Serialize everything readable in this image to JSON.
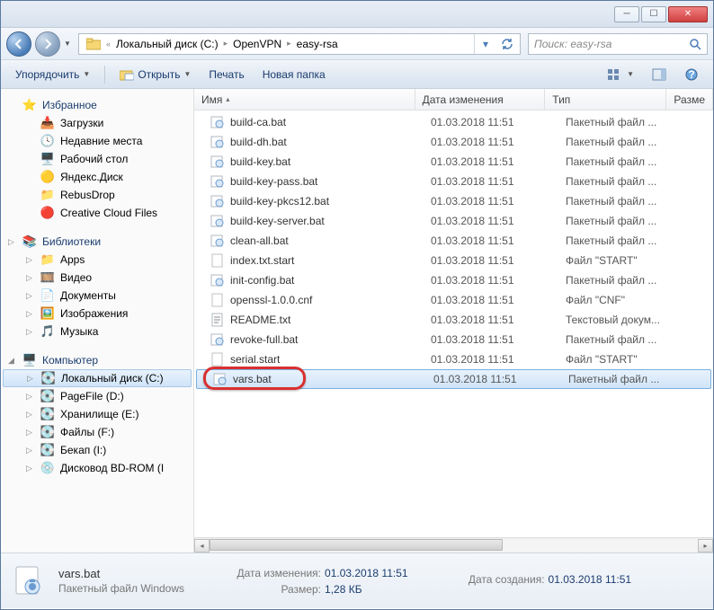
{
  "breadcrumb": {
    "root_sep": "«",
    "seg1": "Локальный диск (C:)",
    "seg2": "OpenVPN",
    "seg3": "easy-rsa"
  },
  "search": {
    "placeholder": "Поиск: easy-rsa"
  },
  "toolbar": {
    "organize": "Упорядочить",
    "open": "Открыть",
    "print": "Печать",
    "newfolder": "Новая папка"
  },
  "sidebar": {
    "favorites": "Избранное",
    "fav_items": [
      "Загрузки",
      "Недавние места",
      "Рабочий стол",
      "Яндекс.Диск",
      "RebusDrop",
      "Creative Cloud Files"
    ],
    "libraries": "Библиотеки",
    "lib_items": [
      "Apps",
      "Видео",
      "Документы",
      "Изображения",
      "Музыка"
    ],
    "computer": "Компьютер",
    "drives": [
      "Локальный диск (C:)",
      "PageFile (D:)",
      "Хранилище (E:)",
      "Файлы (F:)",
      "Бекап (I:)",
      "Дисковод BD-ROM (I"
    ]
  },
  "columns": {
    "name": "Имя",
    "date": "Дата изменения",
    "type": "Тип",
    "size": "Разме"
  },
  "files": [
    {
      "name": "build-ca.bat",
      "date": "01.03.2018 11:51",
      "type": "Пакетный файл ..."
    },
    {
      "name": "build-dh.bat",
      "date": "01.03.2018 11:51",
      "type": "Пакетный файл ..."
    },
    {
      "name": "build-key.bat",
      "date": "01.03.2018 11:51",
      "type": "Пакетный файл ..."
    },
    {
      "name": "build-key-pass.bat",
      "date": "01.03.2018 11:51",
      "type": "Пакетный файл ..."
    },
    {
      "name": "build-key-pkcs12.bat",
      "date": "01.03.2018 11:51",
      "type": "Пакетный файл ..."
    },
    {
      "name": "build-key-server.bat",
      "date": "01.03.2018 11:51",
      "type": "Пакетный файл ..."
    },
    {
      "name": "clean-all.bat",
      "date": "01.03.2018 11:51",
      "type": "Пакетный файл ..."
    },
    {
      "name": "index.txt.start",
      "date": "01.03.2018 11:51",
      "type": "Файл \"START\""
    },
    {
      "name": "init-config.bat",
      "date": "01.03.2018 11:51",
      "type": "Пакетный файл ..."
    },
    {
      "name": "openssl-1.0.0.cnf",
      "date": "01.03.2018 11:51",
      "type": "Файл \"CNF\""
    },
    {
      "name": "README.txt",
      "date": "01.03.2018 11:51",
      "type": "Текстовый докум..."
    },
    {
      "name": "revoke-full.bat",
      "date": "01.03.2018 11:51",
      "type": "Пакетный файл ..."
    },
    {
      "name": "serial.start",
      "date": "01.03.2018 11:51",
      "type": "Файл \"START\""
    },
    {
      "name": "vars.bat",
      "date": "01.03.2018 11:51",
      "type": "Пакетный файл ..."
    }
  ],
  "selected_index": 13,
  "status": {
    "filename": "vars.bat",
    "filetype": "Пакетный файл Windows",
    "date_lbl": "Дата изменения:",
    "date_val": "01.03.2018 11:51",
    "size_lbl": "Размер:",
    "size_val": "1,28 КБ",
    "created_lbl": "Дата создания:",
    "created_val": "01.03.2018 11:51"
  }
}
